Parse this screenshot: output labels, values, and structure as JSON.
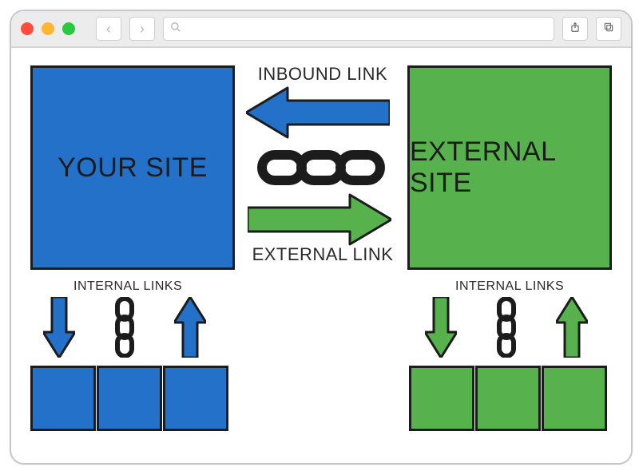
{
  "titlebar": {
    "search_placeholder": ""
  },
  "diagram": {
    "your_site": "YOUR SITE",
    "external_site": "EXTERNAL SITE",
    "inbound_link": "INBOUND LINK",
    "external_link": "EXTERNAL LINK",
    "internal_links_left": "INTERNAL LINKS",
    "internal_links_right": "INTERNAL LINKS"
  },
  "colors": {
    "blue": "#2371c9",
    "green": "#57b14c",
    "stroke": "#1c1c1c"
  }
}
